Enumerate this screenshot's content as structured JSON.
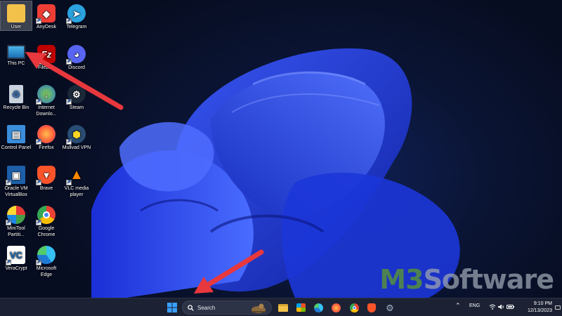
{
  "desktop": {
    "icons": [
      {
        "label": "User",
        "icon": "folder-icon"
      },
      {
        "label": "AnyDesk",
        "icon": "anydesk-icon"
      },
      {
        "label": "Telegram",
        "icon": "telegram-icon"
      },
      {
        "label": "This PC",
        "icon": "monitor-icon"
      },
      {
        "label": "FileZilla",
        "icon": "filezilla-icon"
      },
      {
        "label": "Discord",
        "icon": "discord-icon"
      },
      {
        "label": "Recycle Bin",
        "icon": "recycle-bin-icon"
      },
      {
        "label": "Internet Downlo...",
        "icon": "internet-download-manager-icon"
      },
      {
        "label": "Steam",
        "icon": "steam-icon"
      },
      {
        "label": "Control Panel",
        "icon": "control-panel-icon"
      },
      {
        "label": "Firefox",
        "icon": "firefox-icon"
      },
      {
        "label": "Mullvad VPN",
        "icon": "mullvad-icon"
      },
      {
        "label": "Oracle VM VirtualBox",
        "icon": "virtualbox-icon"
      },
      {
        "label": "Brave",
        "icon": "brave-icon"
      },
      {
        "label": "VLC media player",
        "icon": "vlc-icon"
      },
      {
        "label": "MiniTool Partiti...",
        "icon": "minitool-icon"
      },
      {
        "label": "Google Chrome",
        "icon": "chrome-icon"
      },
      {
        "label": "VeraCrypt",
        "icon": "veracrypt-icon"
      },
      {
        "label": "Microsoft Edge",
        "icon": "edge-icon"
      }
    ]
  },
  "watermark": {
    "brand_a": "M3",
    "brand_b": "Software"
  },
  "taskbar": {
    "search_label": "Search",
    "pinned": [
      "start-icon",
      "file-explorer-icon",
      "microsoft-store-icon",
      "edge-icon",
      "firefox-icon",
      "chrome-icon",
      "brave-icon",
      "settings-icon"
    ],
    "tray": {
      "language": "ENG",
      "time": "9:10 PM",
      "date": "12/13/2023"
    }
  },
  "colors": {
    "arrow": "#e8383d",
    "taskbar": "#1c2233",
    "wallpaper_blue": "#2a4bff",
    "watermark_green": "#5f9c2b",
    "watermark_gray": "#9aa3b0"
  }
}
